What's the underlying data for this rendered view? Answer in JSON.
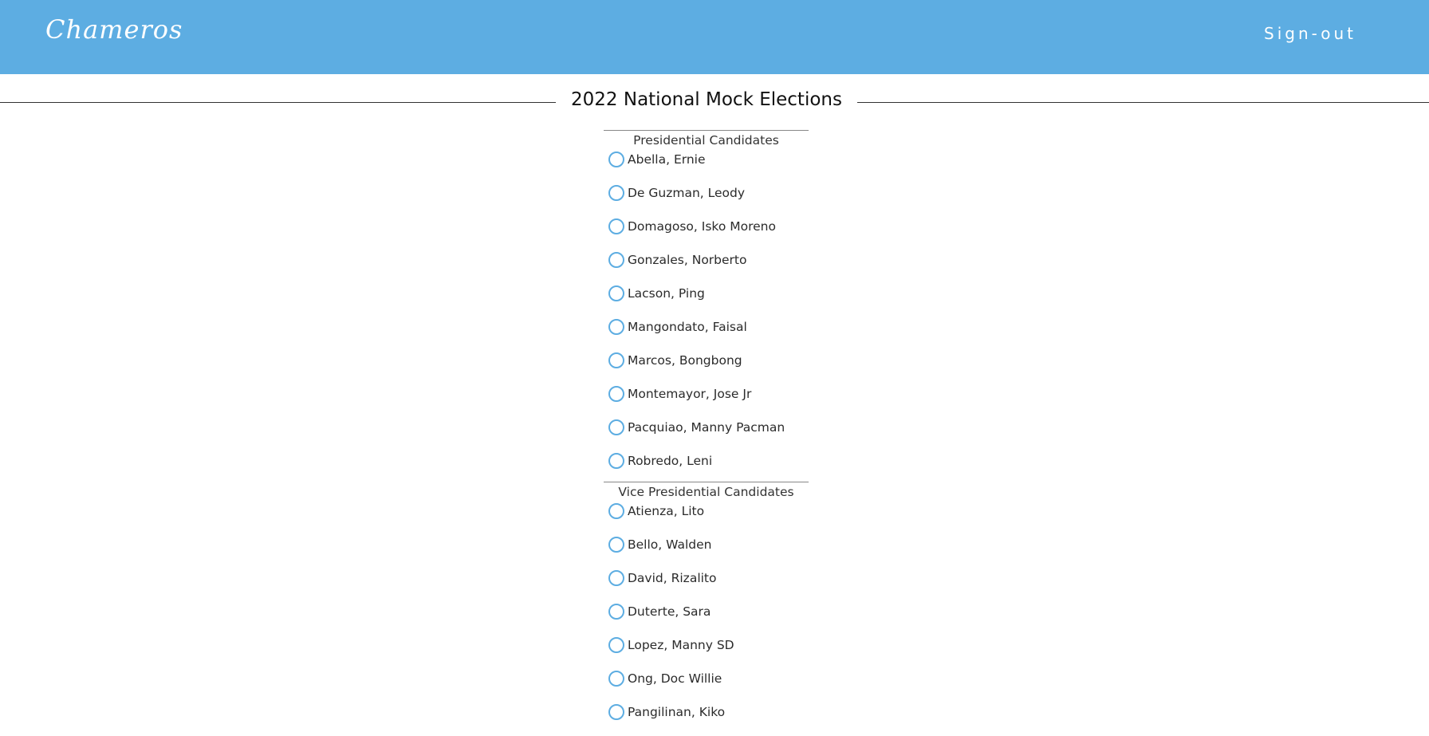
{
  "header": {
    "brand": "Chameros",
    "signout_label": "Sign-out"
  },
  "page_title": "2022 National Mock Elections",
  "colors": {
    "navbar": "#5dade2",
    "radio_border": "#5dade2",
    "text": "#2b2b2b"
  },
  "sections": [
    {
      "heading": "Presidential Candidates",
      "candidates": [
        "Abella, Ernie",
        "De Guzman, Leody",
        "Domagoso, Isko Moreno",
        "Gonzales, Norberto",
        "Lacson, Ping",
        "Mangondato, Faisal",
        "Marcos, Bongbong",
        "Montemayor, Jose Jr",
        "Pacquiao, Manny Pacman",
        "Robredo, Leni"
      ]
    },
    {
      "heading": "Vice Presidential Candidates",
      "candidates": [
        "Atienza, Lito",
        "Bello, Walden",
        "David, Rizalito",
        "Duterte, Sara",
        "Lopez, Manny SD",
        "Ong, Doc Willie",
        "Pangilinan, Kiko"
      ]
    }
  ]
}
